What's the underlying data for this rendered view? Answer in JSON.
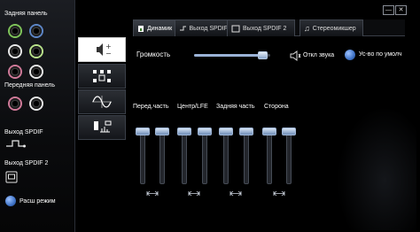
{
  "sidebar": {
    "rear_panel_label": "Задняя панель",
    "front_panel_label": "Передняя панель",
    "spdif_out_label": "Выход SPDIF",
    "spdif_out2_label": "Выход SPDIF 2",
    "advanced_mode_label": "Расш режим"
  },
  "tabs": [
    {
      "label": "Динамик"
    },
    {
      "label": "Выход SPDIF"
    },
    {
      "label": "Выход SPDIF 2"
    },
    {
      "label": "Стереомикшер"
    }
  ],
  "volume": {
    "label": "Громкость",
    "mute_label": "Откл звука",
    "default_label": "Ус-во по умолч",
    "level": 0.9
  },
  "channels": [
    {
      "label": "Перед.часть"
    },
    {
      "label": "Центр/LFE"
    },
    {
      "label": "Задняя часть"
    },
    {
      "label": "Сторона"
    }
  ],
  "window": {
    "minimize": "—",
    "close": "✕"
  },
  "colors": {
    "accent": "#5d86c6",
    "background": "#000000"
  }
}
